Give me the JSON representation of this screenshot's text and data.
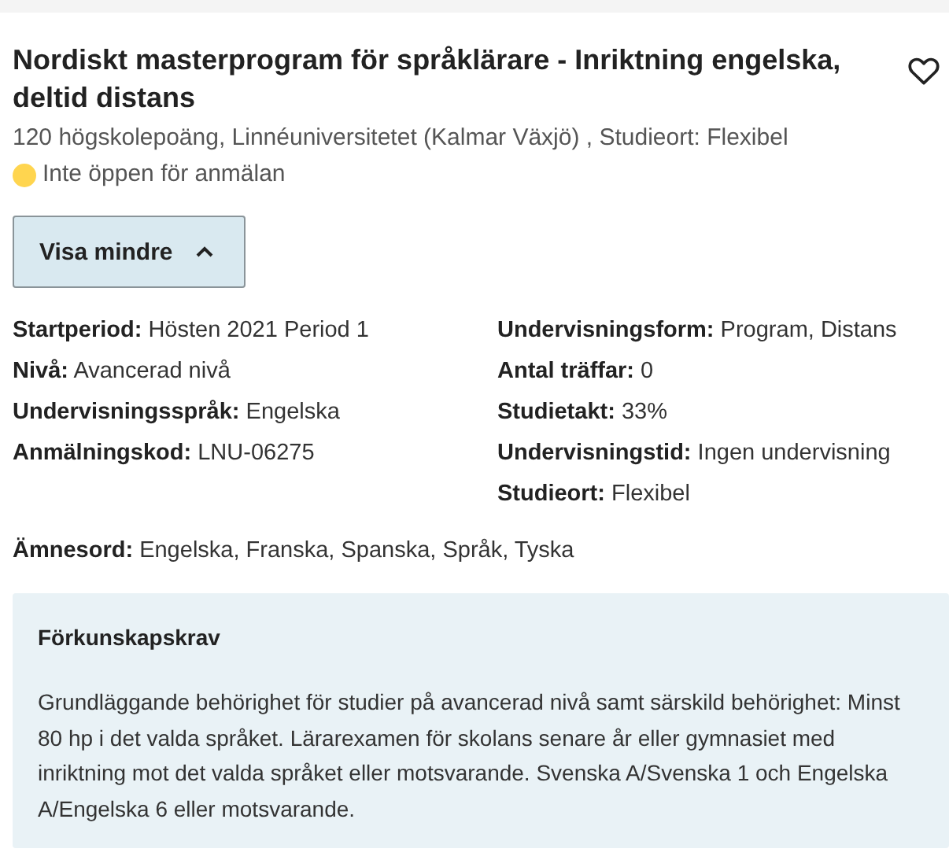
{
  "title": "Nordiskt masterprogram för språklärare - Inriktning engelska, deltid distans",
  "favorited": false,
  "subtitle": "120 högskolepoäng, Linnéuniversitetet (Kalmar Växjö) , Studieort: Flexibel",
  "status": {
    "text": "Inte öppen för anmälan",
    "color": "#ffd54f"
  },
  "toggle": {
    "label": "Visa mindre",
    "expanded": true
  },
  "details_left": [
    {
      "label": "Startperiod:",
      "value": "Hösten 2021 Period 1"
    },
    {
      "label": "Nivå:",
      "value": "Avancerad nivå"
    },
    {
      "label": "Undervisningsspråk:",
      "value": "Engelska"
    },
    {
      "label": "Anmälningskod:",
      "value": "LNU-06275"
    }
  ],
  "details_right": [
    {
      "label": "Undervisningsform:",
      "value": "Program, Distans"
    },
    {
      "label": "Antal träffar:",
      "value": "0"
    },
    {
      "label": "Studietakt:",
      "value": "33%"
    },
    {
      "label": "Undervisningstid:",
      "value": "Ingen undervisning"
    },
    {
      "label": "Studieort:",
      "value": "Flexibel"
    }
  ],
  "subjects": {
    "label": "Ämnesord:",
    "value": "Engelska, Franska, Spanska, Språk, Tyska"
  },
  "prerequisites": {
    "heading": "Förkunskapskrav",
    "text": "Grundläggande behörighet för studier på avancerad nivå samt särskild behörighet: Minst 80 hp i det valda språket. Lärarexamen för skolans senare år eller gymnasiet med inriktning mot det valda språket eller motsvarande. Svenska A/Svenska 1 och Engelska A/Engelska 6 eller motsvarande."
  }
}
